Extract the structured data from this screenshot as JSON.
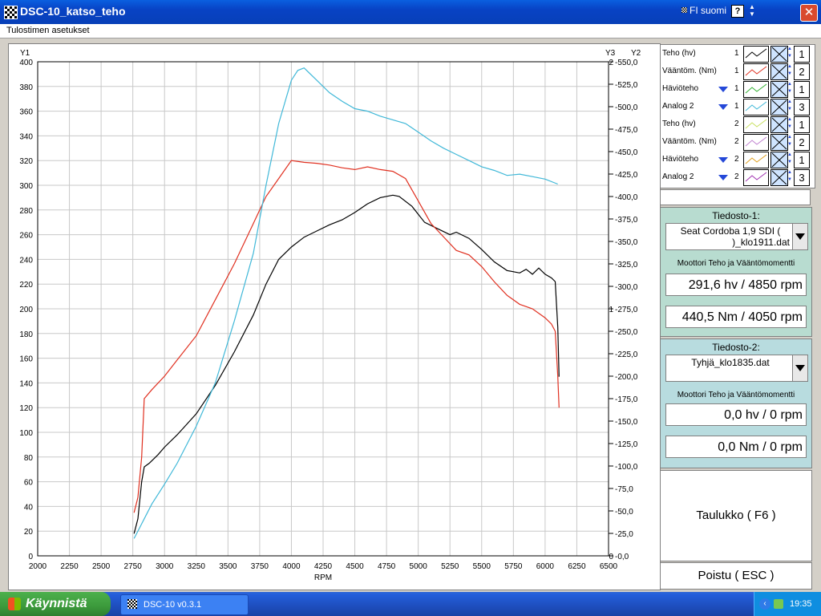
{
  "window": {
    "title": "DSC-10_katso_teho",
    "language": "FI suomi",
    "help_label": "?",
    "close_label": "✕",
    "menu_item": "Tulostimen asetukset"
  },
  "chart_data": {
    "type": "line",
    "xlabel": "RPM",
    "xlim": [
      2000,
      6500
    ],
    "xticks": [
      2000,
      2250,
      2500,
      2750,
      3000,
      3250,
      3500,
      3750,
      4000,
      4250,
      4500,
      4750,
      5000,
      5250,
      5500,
      5750,
      6000,
      6250,
      6500
    ],
    "y1": {
      "label": "Y1",
      "lim": [
        0,
        400
      ],
      "ticks": [
        0,
        20,
        40,
        60,
        80,
        100,
        120,
        140,
        160,
        180,
        200,
        220,
        240,
        260,
        280,
        300,
        320,
        340,
        360,
        380,
        400
      ]
    },
    "y2": {
      "label": "Y2",
      "lim": [
        0,
        550
      ],
      "tick_labels": [
        "-0,0",
        "-25,0",
        "-50,0",
        "-75,0",
        "-100,0",
        "-125,0",
        "-150,0",
        "-175,0",
        "-200,0",
        "-225,0",
        "-250,0",
        "-275,0",
        "-300,0",
        "-325,0",
        "-350,0",
        "-375,0",
        "-400,0",
        "-425,0",
        "-450,0",
        "-475,0",
        "-500,0",
        "-525,0",
        "-550,0"
      ]
    },
    "y3": {
      "label": "Y3",
      "lim": [
        0,
        2
      ],
      "tick_labels": [
        "0",
        "1",
        "2"
      ]
    },
    "grid": true,
    "series": [
      {
        "color": "#000000",
        "axis": "y1",
        "points": [
          [
            2760,
            18
          ],
          [
            2790,
            30
          ],
          [
            2820,
            60
          ],
          [
            2840,
            72
          ],
          [
            2880,
            75
          ],
          [
            2950,
            82
          ],
          [
            3000,
            88
          ],
          [
            3100,
            98
          ],
          [
            3250,
            115
          ],
          [
            3400,
            138
          ],
          [
            3550,
            165
          ],
          [
            3700,
            195
          ],
          [
            3800,
            220
          ],
          [
            3900,
            240
          ],
          [
            4000,
            250
          ],
          [
            4100,
            258
          ],
          [
            4200,
            263
          ],
          [
            4300,
            268
          ],
          [
            4400,
            272
          ],
          [
            4500,
            278
          ],
          [
            4600,
            285
          ],
          [
            4700,
            290
          ],
          [
            4800,
            292
          ],
          [
            4850,
            291
          ],
          [
            4950,
            283
          ],
          [
            5050,
            270
          ],
          [
            5150,
            265
          ],
          [
            5250,
            260
          ],
          [
            5300,
            262
          ],
          [
            5400,
            257
          ],
          [
            5500,
            248
          ],
          [
            5600,
            238
          ],
          [
            5700,
            231
          ],
          [
            5800,
            229
          ],
          [
            5850,
            232
          ],
          [
            5900,
            228
          ],
          [
            5950,
            233
          ],
          [
            6000,
            228
          ],
          [
            6050,
            225
          ],
          [
            6080,
            222
          ],
          [
            6100,
            185
          ],
          [
            6110,
            145
          ]
        ]
      },
      {
        "color": "#e03020",
        "axis": "y2",
        "points": [
          [
            2760,
            48
          ],
          [
            2790,
            65
          ],
          [
            2820,
            110
          ],
          [
            2840,
            175
          ],
          [
            2900,
            185
          ],
          [
            3000,
            200
          ],
          [
            3100,
            218
          ],
          [
            3250,
            245
          ],
          [
            3400,
            285
          ],
          [
            3550,
            325
          ],
          [
            3700,
            370
          ],
          [
            3800,
            400
          ],
          [
            3900,
            420
          ],
          [
            4000,
            440
          ],
          [
            4100,
            438
          ],
          [
            4200,
            437
          ],
          [
            4300,
            435
          ],
          [
            4400,
            432
          ],
          [
            4500,
            430
          ],
          [
            4600,
            433
          ],
          [
            4700,
            430
          ],
          [
            4800,
            428
          ],
          [
            4900,
            420
          ],
          [
            5000,
            395
          ],
          [
            5100,
            370
          ],
          [
            5200,
            355
          ],
          [
            5300,
            340
          ],
          [
            5400,
            335
          ],
          [
            5500,
            322
          ],
          [
            5600,
            305
          ],
          [
            5700,
            290
          ],
          [
            5800,
            280
          ],
          [
            5900,
            275
          ],
          [
            6000,
            265
          ],
          [
            6050,
            258
          ],
          [
            6080,
            250
          ],
          [
            6100,
            200
          ],
          [
            6110,
            165
          ]
        ]
      },
      {
        "color": "#40b8d8",
        "axis": "y1",
        "points": [
          [
            2760,
            14
          ],
          [
            2800,
            22
          ],
          [
            2850,
            32
          ],
          [
            2900,
            42
          ],
          [
            3000,
            58
          ],
          [
            3100,
            75
          ],
          [
            3250,
            105
          ],
          [
            3400,
            140
          ],
          [
            3550,
            190
          ],
          [
            3700,
            245
          ],
          [
            3800,
            300
          ],
          [
            3900,
            350
          ],
          [
            4000,
            385
          ],
          [
            4050,
            393
          ],
          [
            4100,
            395
          ],
          [
            4200,
            385
          ],
          [
            4300,
            375
          ],
          [
            4400,
            368
          ],
          [
            4500,
            362
          ],
          [
            4600,
            360
          ],
          [
            4700,
            356
          ],
          [
            4800,
            353
          ],
          [
            4900,
            350
          ],
          [
            5000,
            343
          ],
          [
            5100,
            336
          ],
          [
            5200,
            330
          ],
          [
            5300,
            325
          ],
          [
            5400,
            320
          ],
          [
            5500,
            315
          ],
          [
            5600,
            312
          ],
          [
            5700,
            308
          ],
          [
            5800,
            309
          ],
          [
            5900,
            307
          ],
          [
            6000,
            305
          ],
          [
            6100,
            301
          ]
        ]
      }
    ]
  },
  "legend": {
    "rows": [
      {
        "label": "Teho (hv)",
        "file": "1",
        "color": "#000000",
        "axis": "1",
        "dropdown": false
      },
      {
        "label": "Vääntöm. (Nm)",
        "file": "1",
        "color": "#e03020",
        "axis": "2",
        "dropdown": false
      },
      {
        "label": "Häviöteho",
        "file": "1",
        "color": "#30b030",
        "axis": "1",
        "dropdown": true
      },
      {
        "label": "Analog 2",
        "file": "1",
        "color": "#40b8d8",
        "axis": "3",
        "dropdown": true
      },
      {
        "label": "Teho (hv)",
        "file": "2",
        "color": "#c8e060",
        "axis": "1",
        "dropdown": false
      },
      {
        "label": "Vääntöm. (Nm)",
        "file": "2",
        "color": "#c080d0",
        "axis": "2",
        "dropdown": false
      },
      {
        "label": "Häviöteho",
        "file": "2",
        "color": "#e0a020",
        "axis": "1",
        "dropdown": true
      },
      {
        "label": "Analog 2",
        "file": "2",
        "color": "#a030b0",
        "axis": "3",
        "dropdown": true
      }
    ]
  },
  "file1": {
    "title": "Tiedosto-1:",
    "file_line1": "Seat Cordoba 1,9 SDI (",
    "file_line2": ")_klo1911.dat",
    "subtitle": "Moottori Teho ja Vääntömomentti",
    "power": "291,6 hv / 4850 rpm",
    "torque": "440,5 Nm / 4050 rpm"
  },
  "file2": {
    "title": "Tiedosto-2:",
    "file_line1": "Tyhjä_klo1835.dat",
    "file_line2": "",
    "subtitle": "Moottori Teho ja Vääntömomentti",
    "power": "0,0 hv / 0 rpm",
    "torque": "0,0 Nm / 0 rpm"
  },
  "buttons": {
    "table": "Taulukko ( F6 )",
    "exit": "Poistu ( ESC )"
  },
  "taskbar": {
    "start": "Käynnistä",
    "task": "DSC-10 v0.3.1",
    "clock": "19:35"
  }
}
